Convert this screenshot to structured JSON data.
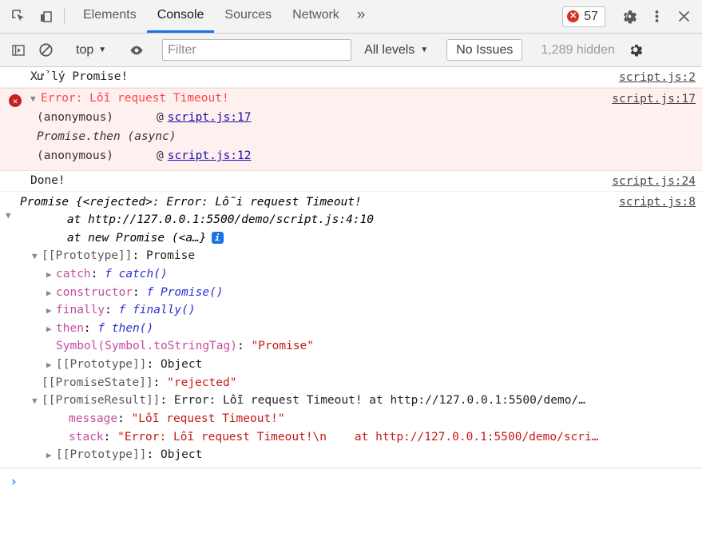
{
  "tabbar": {
    "icons": [
      {
        "name": "inspect-element-icon"
      },
      {
        "name": "device-toolbar-icon"
      }
    ],
    "tabs": [
      {
        "label": "Elements",
        "active": false
      },
      {
        "label": "Console",
        "active": true
      },
      {
        "label": "Sources",
        "active": false
      },
      {
        "label": "Network",
        "active": false
      }
    ],
    "more_label": "»",
    "error_count": "57",
    "error_glyph": "✕",
    "settings_icon": "gear-icon",
    "more_menu_icon": "kebab-menu-icon",
    "close_icon": "close-icon"
  },
  "filterbar": {
    "sidebar_toggle_icon": "sidebar-toggle-icon",
    "clear_console_icon": "clear-console-icon",
    "context_label": "top",
    "eye_icon": "live-expression-icon",
    "filter_placeholder": "Filter",
    "filter_value": "",
    "levels_label": "All levels",
    "issues_label": "No Issues",
    "hidden_label": "1,289 hidden",
    "settings_icon": "console-settings-icon",
    "caret": "▼"
  },
  "colors": {
    "accent": "#1a73e8",
    "error": "#c5221f",
    "error_text": "#ff4444",
    "error_bg": "#fff0f0",
    "link": "#1a0dab",
    "property_key": "#c44ba0",
    "string_value": "#c41a16",
    "function_value": "#2d2dd6"
  },
  "messages": {
    "log1": {
      "text": "Xử lý Promise!",
      "source": "script.js:2"
    },
    "error": {
      "title": "Error: Lỗi request Timeout!",
      "source": "script.js:17",
      "expanded": true,
      "frames": [
        {
          "fn": "(anonymous)",
          "at": "@",
          "link": "script.js:17",
          "async": false
        },
        {
          "fn": "Promise.then (async)",
          "at": "",
          "link": "",
          "async": true
        },
        {
          "fn": "(anonymous)",
          "at": "@",
          "link": "script.js:12",
          "async": false
        }
      ]
    },
    "log2": {
      "text": "Done!",
      "source": "script.js:24"
    },
    "object": {
      "source": "script.js:8",
      "expanded": true,
      "preview": [
        "Promise {<rejected>: Error: Lỗi request Timeout!",
        "    at http://127.0.0.1:5500/demo/script.js:4:10",
        "    at new Promise (<a…}"
      ],
      "info_badge": "i",
      "properties": [
        {
          "indent": 1,
          "tri": "down",
          "key": "[[Prototype]]",
          "key_style": "dim",
          "sep": ": ",
          "value": "Promise",
          "value_style": "plain"
        },
        {
          "indent": 2,
          "tri": "right",
          "key": "catch",
          "key_style": "key",
          "sep": ": ",
          "value": "catch()",
          "value_style": "fn"
        },
        {
          "indent": 2,
          "tri": "right",
          "key": "constructor",
          "key_style": "key",
          "sep": ": ",
          "value": "Promise()",
          "value_style": "fn"
        },
        {
          "indent": 2,
          "tri": "right",
          "key": "finally",
          "key_style": "key",
          "sep": ": ",
          "value": "finally()",
          "value_style": "fn"
        },
        {
          "indent": 2,
          "tri": "right",
          "key": "then",
          "key_style": "key",
          "sep": ": ",
          "value": "then()",
          "value_style": "fn"
        },
        {
          "indent": 2,
          "tri": "none",
          "key": "Symbol(Symbol.toStringTag)",
          "key_style": "key",
          "sep": ": ",
          "value": "\"Promise\"",
          "value_style": "str"
        },
        {
          "indent": 2,
          "tri": "right",
          "key": "[[Prototype]]",
          "key_style": "dim",
          "sep": ": ",
          "value": "Object",
          "value_style": "plain"
        },
        {
          "indent": 1,
          "tri": "none",
          "key": "[[PromiseState]]",
          "key_style": "dim",
          "sep": ": ",
          "value": "\"rejected\"",
          "value_style": "str"
        },
        {
          "indent": 1,
          "tri": "down",
          "key": "[[PromiseResult]]",
          "key_style": "dim",
          "sep": ": ",
          "value": "Error: Lỗi request Timeout! at http://127.0.0.1:5500/demo/…",
          "value_style": "plain"
        },
        {
          "indent": 3,
          "tri": "none",
          "key": "message",
          "key_style": "key",
          "sep": ": ",
          "value": "\"Lỗi request Timeout!\"",
          "value_style": "str"
        },
        {
          "indent": 3,
          "tri": "none",
          "key": "stack",
          "key_style": "key",
          "sep": ": ",
          "value": "\"Error: Lỗi request Timeout!\\n    at http://127.0.0.1:5500/demo/scri…",
          "value_style": "str"
        },
        {
          "indent": 2,
          "tri": "right",
          "key": "[[Prototype]]",
          "key_style": "dim",
          "sep": ": ",
          "value": "Object",
          "value_style": "plain"
        }
      ]
    }
  },
  "prompt": {
    "chevron": "›",
    "value": ""
  }
}
